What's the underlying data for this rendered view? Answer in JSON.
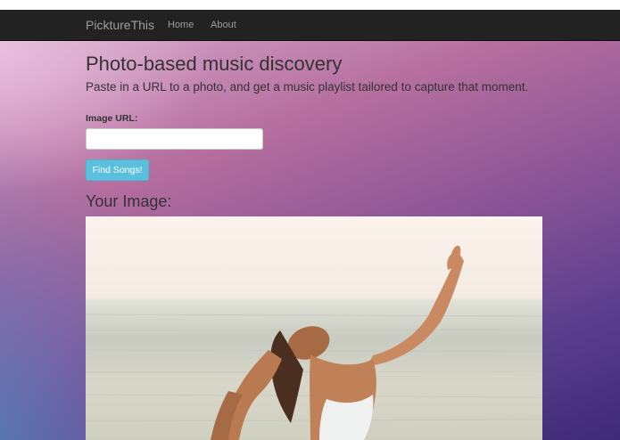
{
  "navbar": {
    "brand": "PicktureThis",
    "links": [
      "Home",
      "About"
    ]
  },
  "main": {
    "title": "Photo-based music discovery",
    "subtitle": "Paste in a URL to a photo, and get a music playlist tailored to capture that moment.",
    "url_label": "Image URL:",
    "url_value": "",
    "find_button": "Find Songs!",
    "image_heading": "Your Image:"
  },
  "colors": {
    "navbar_bg": "#222222",
    "navbar_text": "#9d9d9d",
    "button_bg": "#5bc0de",
    "text": "#333333"
  }
}
